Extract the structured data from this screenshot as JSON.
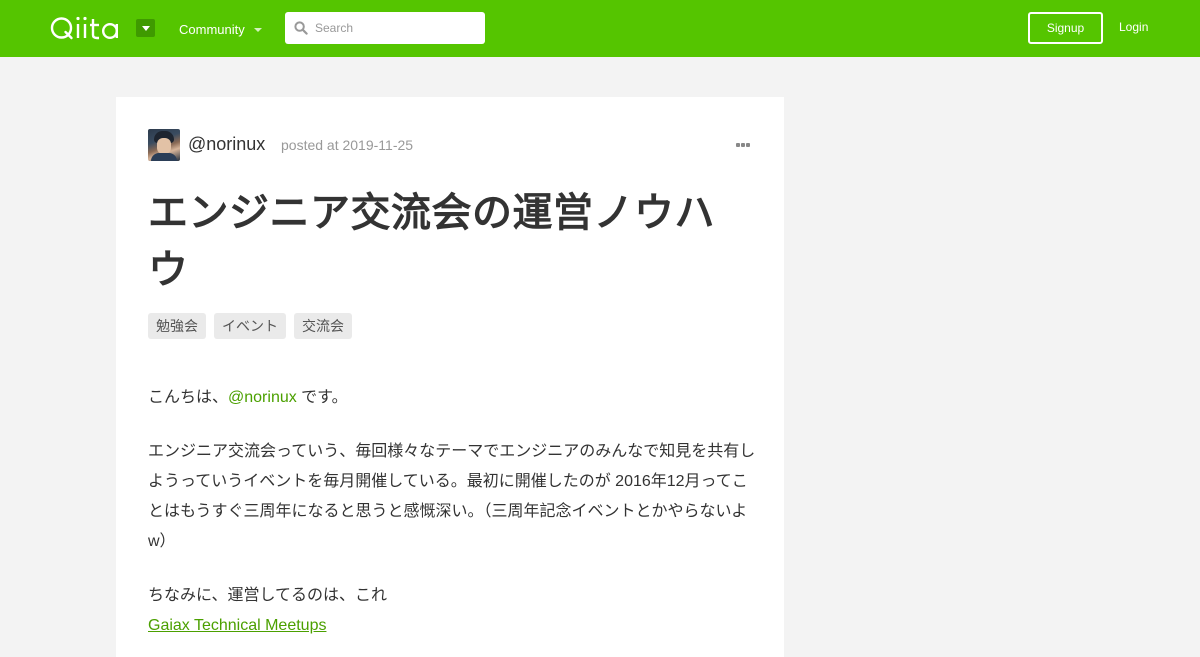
{
  "header": {
    "logo_text": "Qiita",
    "community_label": "Community",
    "search_placeholder": "Search",
    "signup_label": "Signup",
    "login_label": "Login",
    "brand_color": "#55c500"
  },
  "article": {
    "author": "@norinux",
    "posted_at": "posted at 2019-11-25",
    "title": "エンジニア交流会の運営ノウハウ",
    "tags": [
      "勉強会",
      "イベント",
      "交流会"
    ],
    "body": {
      "greeting_prefix": "こんちは、",
      "greeting_mention": "@norinux",
      "greeting_suffix": " です。",
      "paragraph2": "エンジニア交流会っていう、毎回様々なテーマでエンジニアのみんなで知見を共有しようっていうイベントを毎月開催している。最初に開催したのが 2016年12月ってことはもうすぐ三周年になると思うと感慨深い。（三周年記念イベントとかやらないよw）",
      "paragraph3": "ちなみに、運営してるのは、これ",
      "link_text": "Gaiax Technical Meetups"
    }
  }
}
